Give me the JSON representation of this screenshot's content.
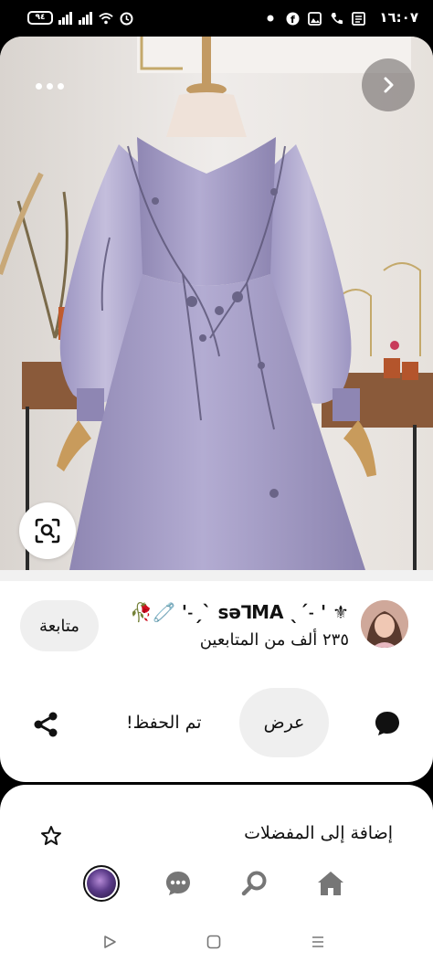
{
  "status_bar": {
    "time": "١٦:٠٧",
    "battery": "٩٤"
  },
  "icons": {
    "more": "more-icon",
    "next": "chevron-right-icon",
    "lens": "visual-search-icon",
    "comment": "comment-icon",
    "share": "share-icon",
    "star": "star-icon",
    "home": "home-icon",
    "search": "search-icon",
    "messages": "messages-icon"
  },
  "pin": {
    "author_name": "🥀🧷 '˗ˏˋ sǝꓶMA ˎˊ˗ ' ⚜",
    "followers": "٢٣٥ ألف من المتابعين",
    "follow_label": "متابعة"
  },
  "actions": {
    "view_label": "عرض",
    "saved_label": "تم الحفظ!"
  },
  "sheet": {
    "favorites_label": "إضافة إلى المفضلات"
  },
  "colors": {
    "dress": "#a49cc6",
    "background": "#e8e5e2",
    "pill": "#efefef"
  }
}
